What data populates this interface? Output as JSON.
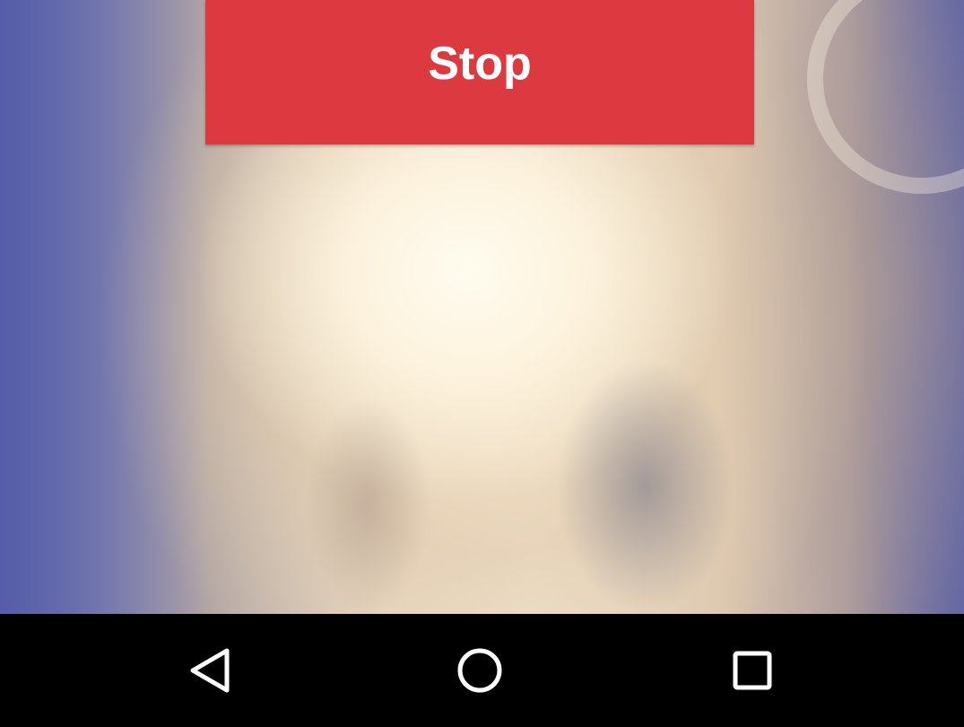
{
  "camera": {
    "stop_label": "Stop",
    "stop_color": "#dc3a40"
  },
  "nav_bar": {
    "background": "#000000",
    "buttons": [
      {
        "name": "back",
        "icon": "back-triangle-icon"
      },
      {
        "name": "home",
        "icon": "home-circle-icon"
      },
      {
        "name": "recents",
        "icon": "recents-square-icon"
      }
    ]
  }
}
